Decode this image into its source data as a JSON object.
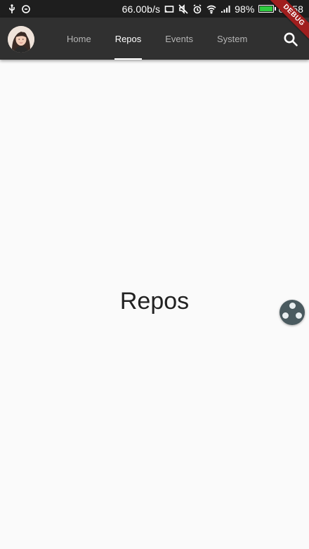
{
  "status_bar": {
    "net_speed": "66.00b/s",
    "battery_percent": "98%",
    "battery_level": 0.98,
    "time": "00:58",
    "icons": [
      "usb-icon",
      "sync-icon",
      "cast-icon",
      "mute-icon",
      "alarm-icon",
      "wifi-icon",
      "signal-icon",
      "battery-icon"
    ],
    "battery_color": "#2ecc40"
  },
  "app_bar": {
    "background": "#303030",
    "tabs": [
      {
        "label": "Home"
      },
      {
        "label": "Repos"
      },
      {
        "label": "Events"
      },
      {
        "label": "System"
      }
    ],
    "active_tab": "Repos",
    "search_icon": "search-icon",
    "avatar": "user-avatar"
  },
  "debug_banner": "DEBUG",
  "main": {
    "label": "Repos"
  },
  "floating_ball": {
    "icon": "assistive-ball-icon",
    "color": "#4a5a5f"
  }
}
